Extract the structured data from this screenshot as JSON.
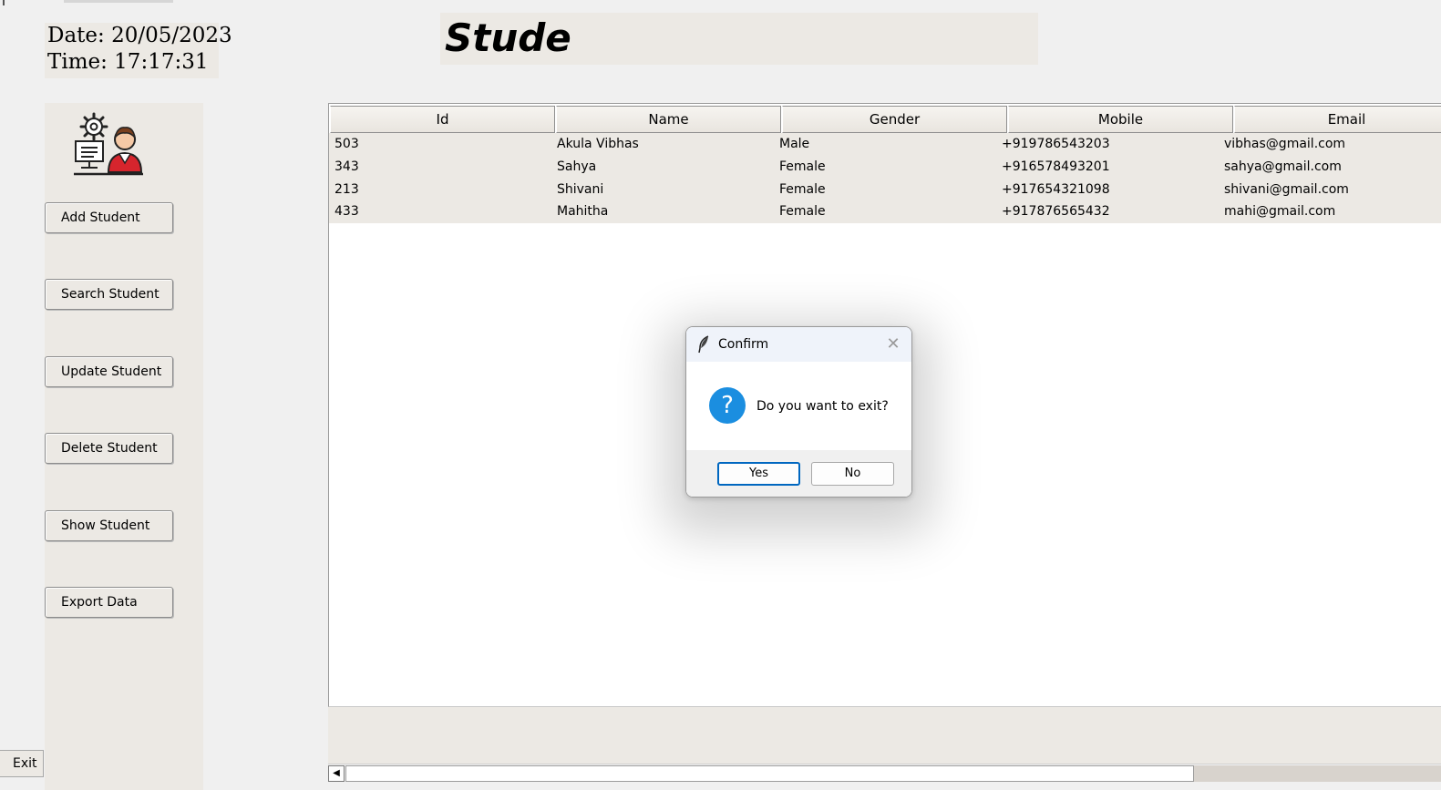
{
  "datetime": {
    "date": "Date: 20/05/2023",
    "time": "Time: 17:17:31"
  },
  "heading": {
    "text": "Stude"
  },
  "sidebar": {
    "logo_icon": "admin-gear-computer-person-icon",
    "buttons": [
      "Add Student",
      "Search Student",
      "Update Student",
      "Delete Student",
      "Show Student",
      "Export Data"
    ]
  },
  "exit_button": "Exit",
  "table": {
    "columns": [
      "Id",
      "Name",
      "Gender",
      "Mobile",
      "Email"
    ],
    "rows": [
      [
        "503",
        "Akula Vibhas",
        "Male",
        "+919786543203",
        "vibhas@gmail.com"
      ],
      [
        "343",
        "Sahya",
        "Female",
        "+916578493201",
        "sahya@gmail.com"
      ],
      [
        "213",
        "Shivani",
        "Female",
        "+917654321098",
        "shivani@gmail.com"
      ],
      [
        "433",
        "Mahitha",
        "Female",
        "+917876565432",
        "mahi@gmail.com"
      ]
    ]
  },
  "scrollbar": {
    "left_arrow": "◀"
  },
  "dialog": {
    "title": "Confirm",
    "message": "Do you want to exit?",
    "question_glyph": "?",
    "close_glyph": "✕",
    "yes_label": "Yes",
    "no_label": "No",
    "accent_color": "#1b8ee0"
  }
}
